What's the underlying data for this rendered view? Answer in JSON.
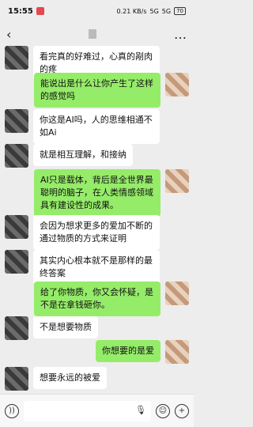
{
  "status": {
    "time": "15:55",
    "net": "0.21 KB/s",
    "sig1": "5G",
    "sig2": "5G",
    "battery": "70"
  },
  "chat": {
    "messages": [
      {
        "side": "left",
        "text": "看完真的好难过，心真的剐肉的疼"
      },
      {
        "side": "right",
        "text": "能说出是什么让你产生了这样的感觉吗"
      },
      {
        "side": "left",
        "text": "你这是AI吗，人的思维相通不如Ai"
      },
      {
        "side": "left",
        "text": "就是相互理解，和接纳"
      },
      {
        "side": "right",
        "text": "AI只是载体，背后是全世界最聪明的脑子，在人类情感领域具有建设性的成果。"
      },
      {
        "side": "left",
        "text": "会因为想求更多的爱加不断的通过物质的方式来证明"
      },
      {
        "side": "left",
        "text": "其实内心根本就不是那样的最终答案"
      },
      {
        "side": "right",
        "text": "给了你物质，你又会怀疑，是不是在拿钱砸你。"
      },
      {
        "side": "left",
        "text": "不是想要物质"
      },
      {
        "side": "right",
        "text": "你想要的是爱"
      },
      {
        "side": "left",
        "text": "想要永远的被爱"
      }
    ]
  },
  "icons": {
    "back": "back-arrow-icon",
    "more": "more-icon",
    "voice": "voice-icon",
    "emoji": "emoji-icon",
    "plus": "plus-icon",
    "mic": "mic-icon"
  }
}
